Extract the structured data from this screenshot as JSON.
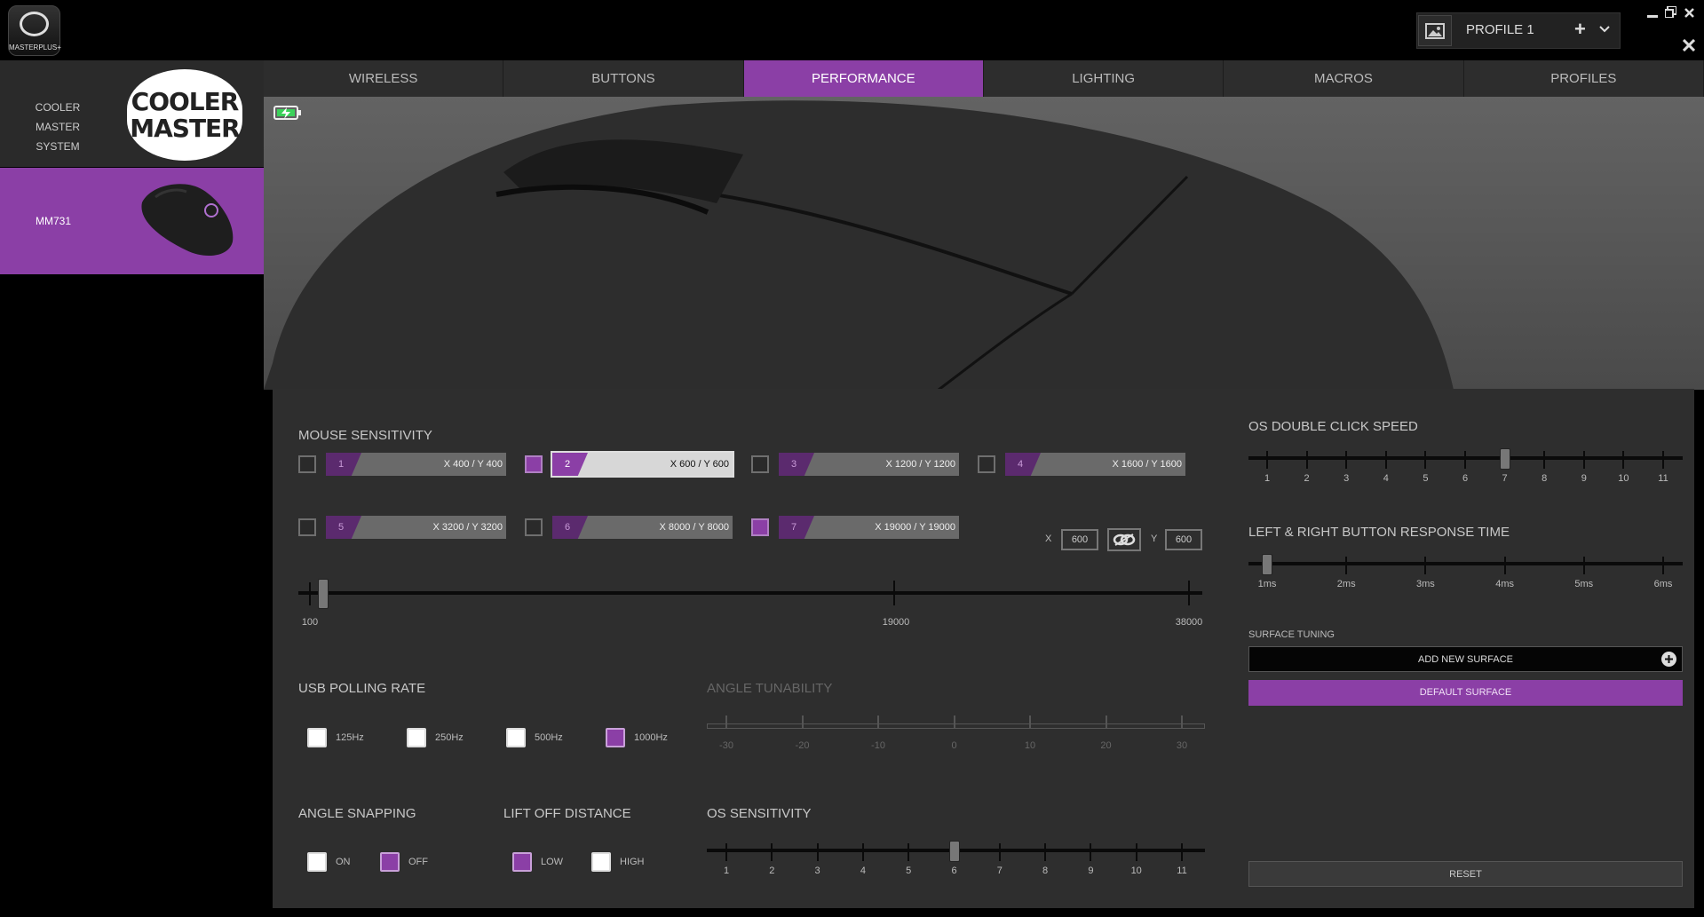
{
  "app": {
    "logo_text": "MASTERPLUS+"
  },
  "profile": {
    "name": "PROFILE 1",
    "add": "+",
    "chevron": "⌄"
  },
  "window": {
    "minimize": "▬",
    "restore": "❐",
    "close": "✕",
    "extra": "✖"
  },
  "sidebar": {
    "system_label_1": "COOLER MASTER",
    "system_label_2": "SYSTEM",
    "brand_1": "COOLER",
    "brand_2": "MASTER",
    "device": "MM731"
  },
  "tabs": [
    {
      "label": "WIRELESS",
      "active": false
    },
    {
      "label": "BUTTONS",
      "active": false
    },
    {
      "label": "PERFORMANCE",
      "active": true
    },
    {
      "label": "LIGHTING",
      "active": false
    },
    {
      "label": "MACROS",
      "active": false
    },
    {
      "label": "PROFILES",
      "active": false
    }
  ],
  "sensitivity": {
    "title": "MOUSE SENSITIVITY",
    "stages": [
      {
        "n": "1",
        "value": "X 400 / Y 400",
        "enabled": false,
        "selected": false
      },
      {
        "n": "2",
        "value": "X 600 / Y 600",
        "enabled": true,
        "selected": true
      },
      {
        "n": "3",
        "value": "X 1200 / Y 1200",
        "enabled": false,
        "selected": false
      },
      {
        "n": "4",
        "value": "X 1600 / Y 1600",
        "enabled": false,
        "selected": false
      },
      {
        "n": "5",
        "value": "X 3200 / Y 3200",
        "enabled": false,
        "selected": false
      },
      {
        "n": "6",
        "value": "X 8000 / Y 8000",
        "enabled": false,
        "selected": false
      },
      {
        "n": "7",
        "value": "X 19000 / Y 19000",
        "enabled": true,
        "selected": false
      }
    ],
    "x_label": "X",
    "x_value": "600",
    "y_label": "Y",
    "y_value": "600",
    "slider_min": "100",
    "slider_mid": "19000",
    "slider_max": "38000",
    "slider_value": 600
  },
  "polling": {
    "title": "USB POLLING RATE",
    "options": [
      {
        "label": "125Hz",
        "on": false
      },
      {
        "label": "250Hz",
        "on": false
      },
      {
        "label": "500Hz",
        "on": false
      },
      {
        "label": "1000Hz",
        "on": true
      }
    ]
  },
  "angle_tunability": {
    "title": "ANGLE TUNABILITY",
    "labels": [
      "-30",
      "-20",
      "-10",
      "0",
      "10",
      "20",
      "30"
    ]
  },
  "angle_snapping": {
    "title": "ANGLE SNAPPING",
    "options": [
      {
        "label": "ON",
        "on": false
      },
      {
        "label": "OFF",
        "on": true
      }
    ]
  },
  "lift_off": {
    "title": "LIFT OFF DISTANCE",
    "options": [
      {
        "label": "LOW",
        "on": true
      },
      {
        "label": "HIGH",
        "on": false
      }
    ]
  },
  "os_sensitivity": {
    "title": "OS SENSITIVITY",
    "labels": [
      "1",
      "2",
      "3",
      "4",
      "5",
      "6",
      "7",
      "8",
      "9",
      "10",
      "11"
    ],
    "value": 6
  },
  "double_click": {
    "title": "OS DOUBLE CLICK SPEED",
    "labels": [
      "1",
      "2",
      "3",
      "4",
      "5",
      "6",
      "7",
      "8",
      "9",
      "10",
      "11"
    ],
    "value": 7
  },
  "response_time": {
    "title": "LEFT & RIGHT BUTTON RESPONSE TIME",
    "labels": [
      "1ms",
      "2ms",
      "3ms",
      "4ms",
      "5ms",
      "6ms"
    ],
    "value": "1ms"
  },
  "surface": {
    "title": "SURFACE TUNING",
    "add_label": "ADD NEW SURFACE",
    "default_label": "DEFAULT SURFACE"
  },
  "reset_label": "RESET",
  "colors": {
    "accent": "#8b3fa6",
    "panel": "#2e2e2e",
    "tab_bar": "#2d2d2d"
  }
}
